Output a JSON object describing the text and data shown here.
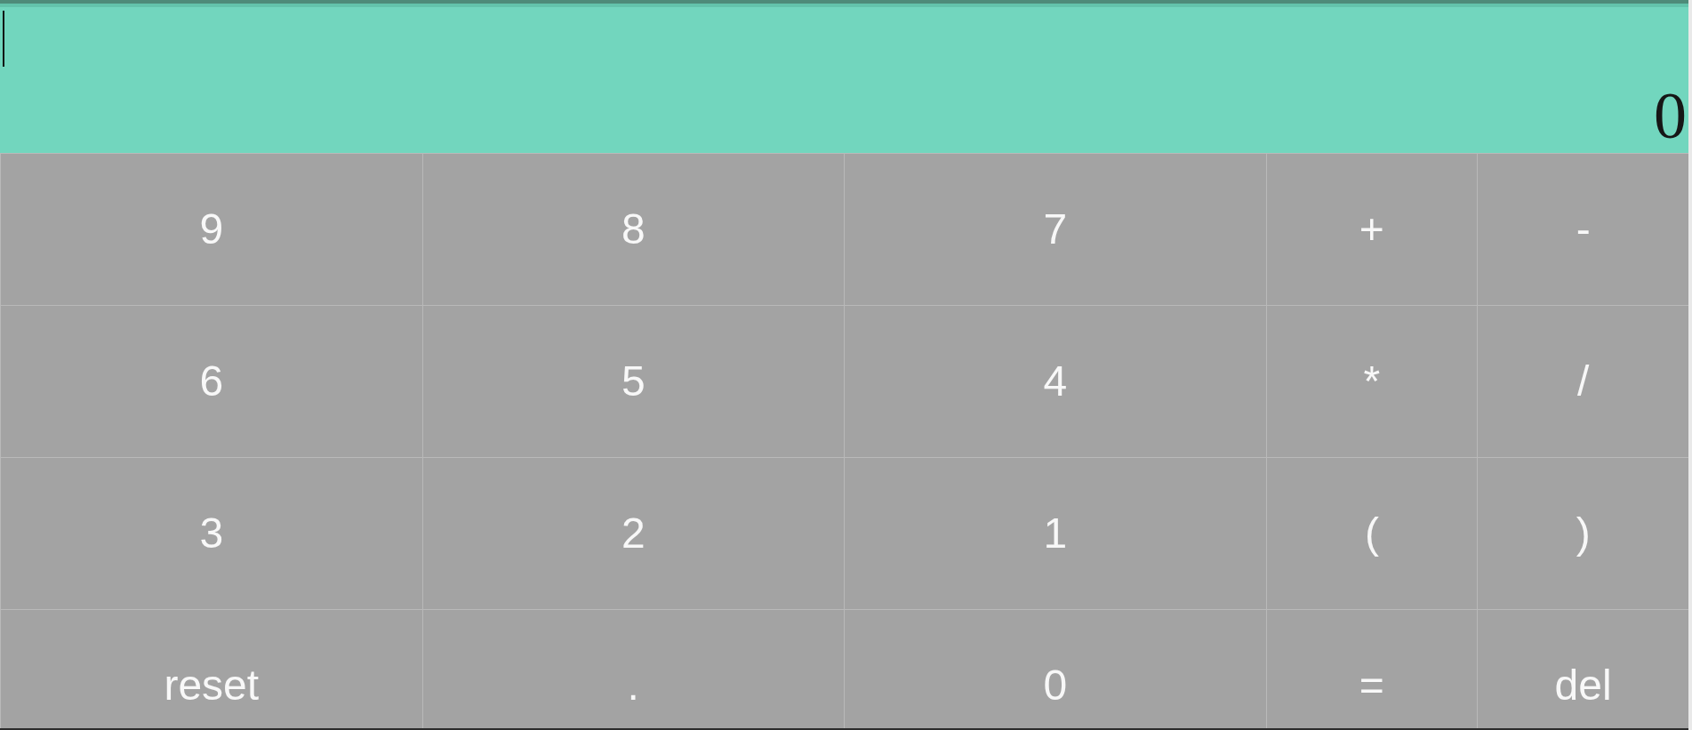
{
  "display": {
    "input": {
      "focused": true
    },
    "result": "0"
  },
  "keys": [
    "9",
    "8",
    "7",
    "+",
    "-",
    "6",
    "5",
    "4",
    "*",
    "/",
    "3",
    "2",
    "1",
    "(",
    ")",
    "reset",
    ".",
    "0",
    "=",
    "del"
  ]
}
